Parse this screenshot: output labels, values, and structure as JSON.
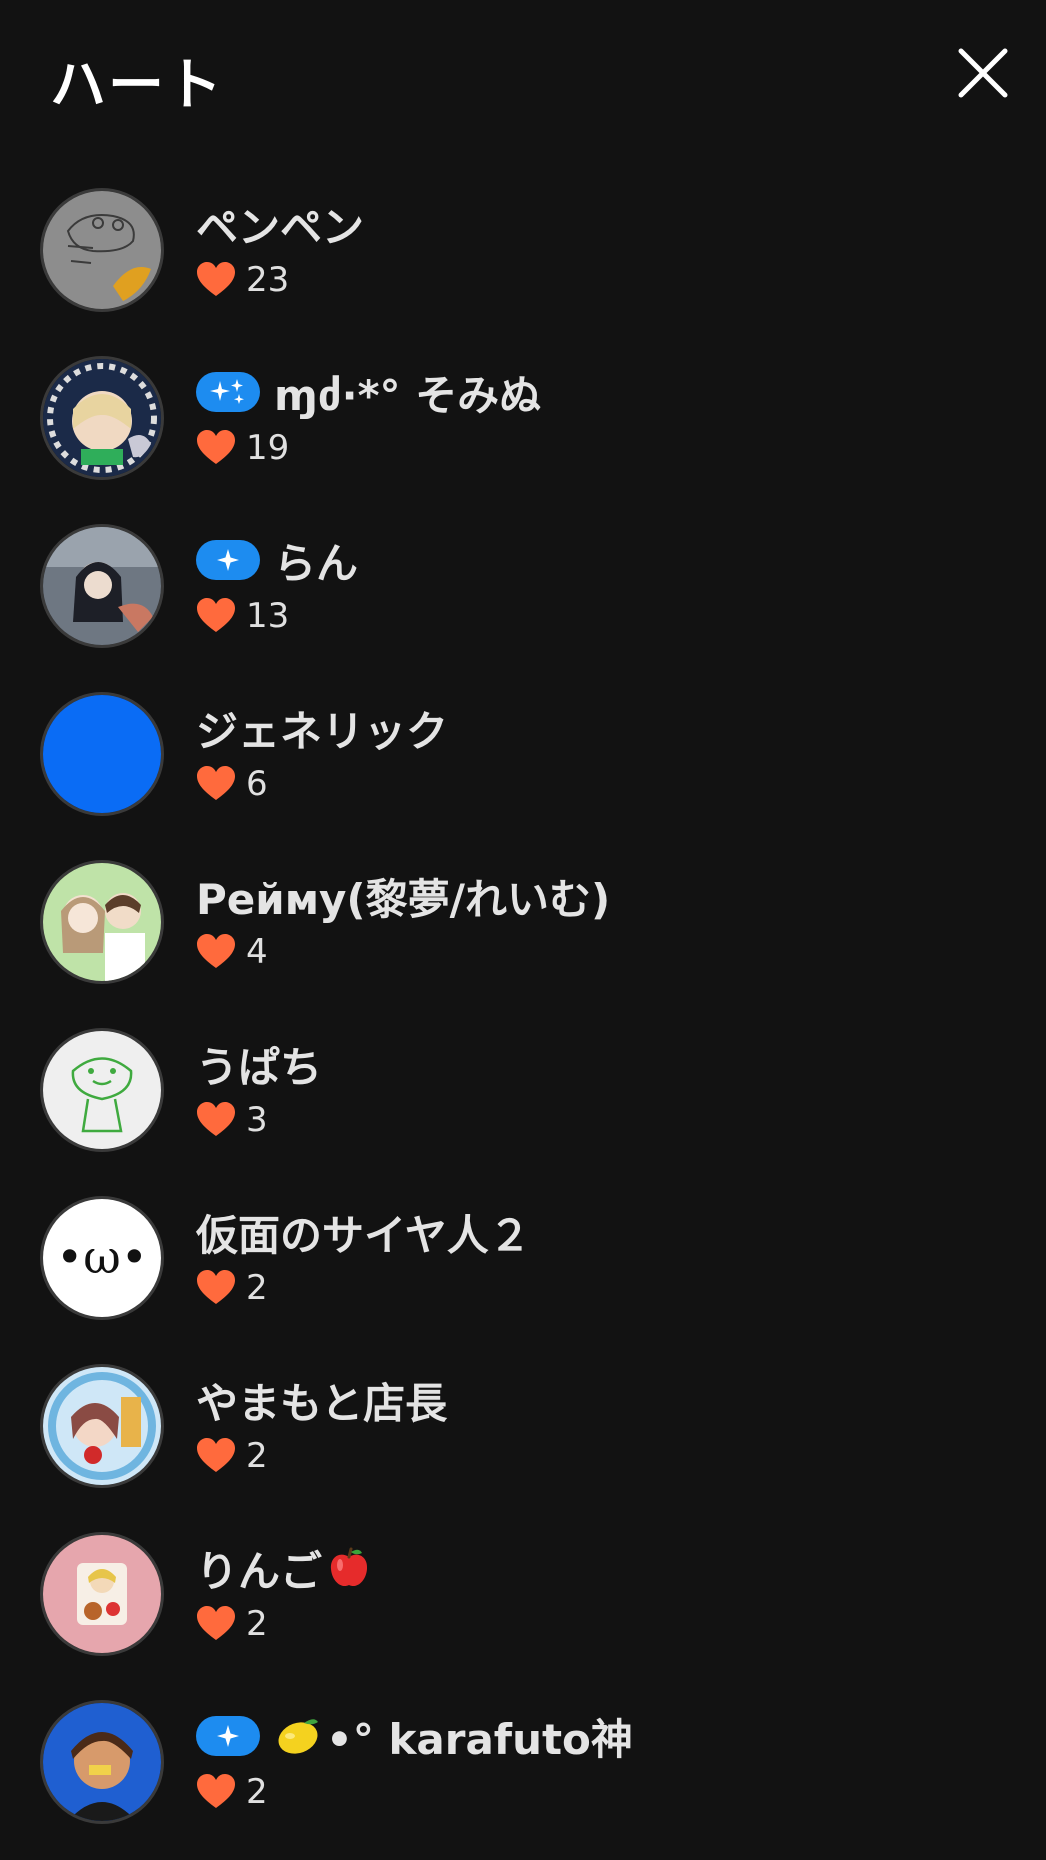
{
  "header": {
    "title": "ハート"
  },
  "users": [
    {
      "name": "ペンペン",
      "count": "23",
      "badge": "none"
    },
    {
      "name": "ɱძ·*° そみぬ",
      "count": "19",
      "badge": "sparkles"
    },
    {
      "name": "らん",
      "count": "13",
      "badge": "sparkle"
    },
    {
      "name": "ジェネリック",
      "count": "6",
      "badge": "none"
    },
    {
      "name": "Рейму(黎夢/れいむ)",
      "count": "4",
      "badge": "none"
    },
    {
      "name": "うぱち",
      "count": "3",
      "badge": "none"
    },
    {
      "name": "仮面のサイヤ人２",
      "count": "2",
      "badge": "none"
    },
    {
      "name": "やまもと店長",
      "count": "2",
      "badge": "none"
    },
    {
      "name": "りんご",
      "count": "2",
      "badge": "none",
      "emoji": "apple"
    },
    {
      "name": "•° karafuto神",
      "count": "2",
      "badge": "sparkle",
      "emoji": "lemon"
    }
  ],
  "avatar_texts": {
    "omega": "•ω•"
  },
  "colors": {
    "background": "#121212",
    "badge_blue": "#1d8cf0",
    "heart": "#ff6a3d",
    "text": "#e4e4e4",
    "avatar_blue": "#0a6cf5"
  },
  "icons": {
    "close": "close-icon",
    "heart": "heart-icon",
    "sparkle": "sparkle-icon"
  }
}
